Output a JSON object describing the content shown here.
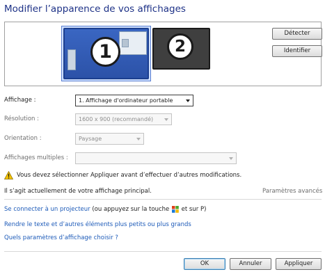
{
  "page": {
    "title": "Modifier l’apparence de vos affichages"
  },
  "preview": {
    "monitor1_number": "1",
    "monitor2_number": "2",
    "detect_label": "Détecter",
    "identify_label": "Identifier"
  },
  "form": {
    "display_label": "Affichage :",
    "display_value": "1. Affichage d'ordinateur portable",
    "resolution_label": "Résolution :",
    "resolution_value": "1600 x 900 (recommandé)",
    "orientation_label": "Orientation :",
    "orientation_value": "Paysage",
    "multiple_label": "Affichages multiples :",
    "multiple_value": ""
  },
  "warning": {
    "text": "Vous devez sélectionner Appliquer avant d’effectuer d’autres modifications."
  },
  "status": {
    "primary_text": "Il s’agit actuellement de votre affichage principal.",
    "advanced_link": "Paramètres avancés"
  },
  "links": {
    "projector_link": "Se connecter à un projecteur",
    "projector_suffix_a": " (ou appuyez sur la touche ",
    "projector_suffix_b": " et sur P)",
    "text_size_link": "Rendre le texte et d’autres éléments plus petits ou plus grands",
    "which_settings_link": "Quels paramètres d’affichage choisir ?"
  },
  "buttons": {
    "ok": "OK",
    "cancel": "Annuler",
    "apply": "Appliquer"
  },
  "icons": {
    "warning": "warning-icon",
    "windows_key": "windows-logo-icon",
    "dropdown": "chevron-down-icon"
  },
  "colors": {
    "title": "#1e3287",
    "link": "#1c5ab8",
    "selected_monitor": "#2c52a8"
  }
}
